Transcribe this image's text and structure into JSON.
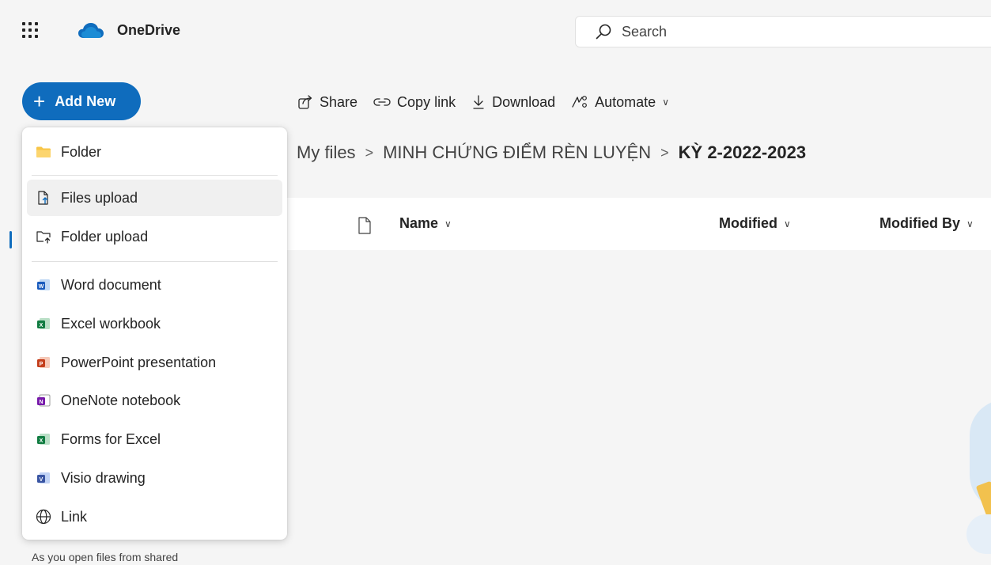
{
  "app": {
    "name": "OneDrive",
    "brand_color": "#0f6cbd"
  },
  "search": {
    "placeholder": "Search"
  },
  "add_new": {
    "label": "Add New"
  },
  "toolbar": {
    "share": "Share",
    "copy_link": "Copy link",
    "download": "Download",
    "automate": "Automate"
  },
  "breadcrumb": {
    "root": "My files",
    "parent": "MINH CHỨNG ĐIỂM RÈN LUYỆN",
    "current": "KỲ 2-2022-2023"
  },
  "columns": {
    "name": "Name",
    "modified": "Modified",
    "modified_by": "Modified By"
  },
  "menu": {
    "items": [
      {
        "label": "Folder",
        "icon": "folder-icon"
      },
      {
        "label": "Files upload",
        "icon": "files-upload-icon",
        "hovered": true
      },
      {
        "label": "Folder upload",
        "icon": "folder-upload-icon"
      },
      {
        "label": "Word document",
        "icon": "word-icon"
      },
      {
        "label": "Excel workbook",
        "icon": "excel-icon"
      },
      {
        "label": "PowerPoint presentation",
        "icon": "powerpoint-icon"
      },
      {
        "label": "OneNote notebook",
        "icon": "onenote-icon"
      },
      {
        "label": "Forms for Excel",
        "icon": "forms-excel-icon"
      },
      {
        "label": "Visio drawing",
        "icon": "visio-icon"
      },
      {
        "label": "Link",
        "icon": "globe-icon"
      }
    ]
  },
  "left_nav": {
    "footer_text": "As you open files from shared"
  }
}
